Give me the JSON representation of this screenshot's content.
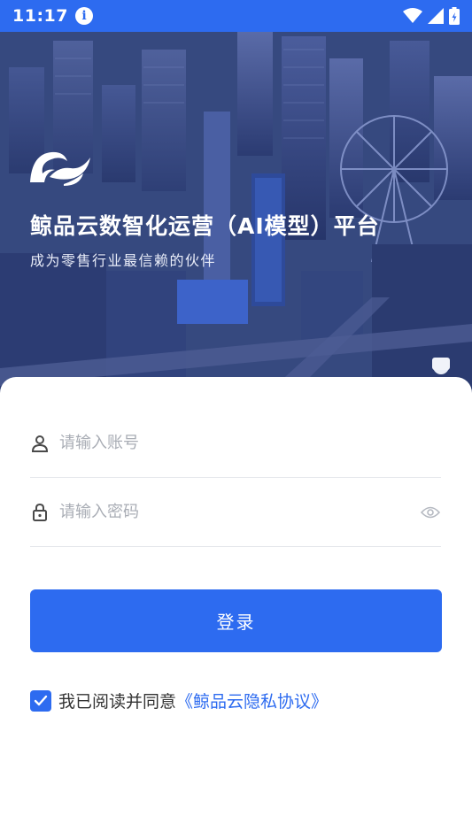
{
  "status_bar": {
    "time": "11:17"
  },
  "hero": {
    "title": "鲸品云数智化运营（AI模型）平台",
    "subtitle": "成为零售行业最信赖的伙伴"
  },
  "login": {
    "account_placeholder": "请输入账号",
    "password_placeholder": "请输入密码",
    "login_label": "登录",
    "agree_text": "我已阅读并同意",
    "agree_link": "《鲸品云隐私协议》",
    "agree_checked": true
  },
  "colors": {
    "accent": "#2d6bf0",
    "hero_bg": "#344883"
  }
}
